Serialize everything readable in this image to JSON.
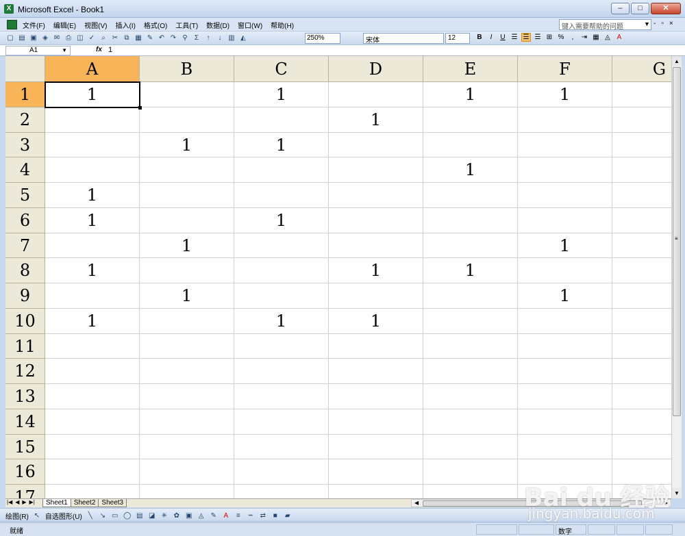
{
  "window": {
    "title": "Microsoft Excel - Book1",
    "app_icon": "X",
    "min": "–",
    "max": "□",
    "close": "✕"
  },
  "menu": {
    "items": [
      "文件(F)",
      "编辑(E)",
      "视图(V)",
      "插入(I)",
      "格式(O)",
      "工具(T)",
      "数据(D)",
      "窗口(W)",
      "帮助(H)"
    ],
    "help_placeholder": "键入需要帮助的问题",
    "mdi_min": "-",
    "mdi_restore": "▫",
    "mdi_close": "×"
  },
  "toolbar": {
    "zoom": "250%",
    "font": "宋体",
    "font_size": "12",
    "bold": "B",
    "italic": "I",
    "underline": "U",
    "percent": "%"
  },
  "formula_bar": {
    "name_box": "A1",
    "fx": "fx",
    "formula": "1"
  },
  "grid": {
    "columns": [
      "A",
      "B",
      "C",
      "D",
      "E",
      "F",
      "G"
    ],
    "rows": [
      "1",
      "2",
      "3",
      "4",
      "5",
      "6",
      "7",
      "8",
      "9",
      "10",
      "11",
      "12",
      "13",
      "14",
      "15",
      "16",
      "17"
    ],
    "selected_cell": "A1",
    "cells": [
      [
        "1",
        "",
        "1",
        "",
        "1",
        "1",
        ""
      ],
      [
        "",
        "",
        "",
        "1",
        "",
        "",
        ""
      ],
      [
        "",
        "1",
        "1",
        "",
        "",
        "",
        ""
      ],
      [
        "",
        "",
        "",
        "",
        "1",
        "",
        ""
      ],
      [
        "1",
        "",
        "",
        "",
        "",
        "",
        ""
      ],
      [
        "1",
        "",
        "1",
        "",
        "",
        "",
        ""
      ],
      [
        "",
        "1",
        "",
        "",
        "",
        "1",
        ""
      ],
      [
        "1",
        "",
        "",
        "1",
        "1",
        "",
        ""
      ],
      [
        "",
        "1",
        "",
        "",
        "",
        "1",
        ""
      ],
      [
        "1",
        "",
        "1",
        "1",
        "",
        "",
        ""
      ],
      [
        "",
        "",
        "",
        "",
        "",
        "",
        ""
      ],
      [
        "",
        "",
        "",
        "",
        "",
        "",
        ""
      ],
      [
        "",
        "",
        "",
        "",
        "",
        "",
        ""
      ],
      [
        "",
        "",
        "",
        "",
        "",
        "",
        ""
      ],
      [
        "",
        "",
        "",
        "",
        "",
        "",
        ""
      ],
      [
        "",
        "",
        "",
        "",
        "",
        "",
        ""
      ],
      [
        "",
        "",
        "",
        "",
        "",
        "",
        ""
      ]
    ]
  },
  "sheet_tabs": [
    "Sheet1",
    "Sheet2",
    "Sheet3"
  ],
  "active_sheet": "Sheet1",
  "draw_toolbar": {
    "draw": "绘图(R)",
    "autoshapes": "自选图形(U)"
  },
  "status": {
    "ready": "就绪",
    "mode": "数字"
  },
  "watermark": {
    "brand": "Bai du 经验",
    "url": "jingyan.baidu.com"
  }
}
